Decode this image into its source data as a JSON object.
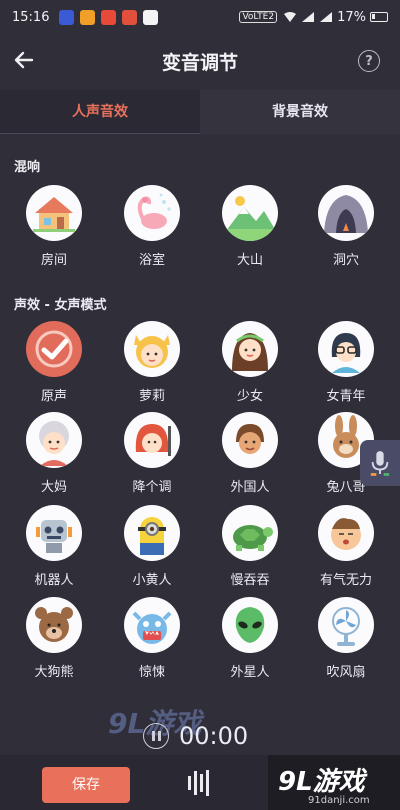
{
  "status_bar": {
    "time": "15:16",
    "network_label": "VoLTE2",
    "battery": "17%"
  },
  "header": {
    "title": "变音调节"
  },
  "tabs": [
    {
      "label": "人声音效",
      "active": true
    },
    {
      "label": "背景音效",
      "active": false
    }
  ],
  "sections": {
    "reverb": {
      "title": "混响",
      "items": [
        {
          "label": "房间",
          "icon": "house-icon"
        },
        {
          "label": "浴室",
          "icon": "flamingo-icon"
        },
        {
          "label": "大山",
          "icon": "mountain-icon"
        },
        {
          "label": "洞穴",
          "icon": "cave-icon"
        }
      ]
    },
    "voice": {
      "title": "声效 - 女声模式",
      "items": [
        {
          "label": "原声",
          "icon": "check-icon"
        },
        {
          "label": "萝莉",
          "icon": "girl-cat-ears-icon"
        },
        {
          "label": "少女",
          "icon": "young-woman-icon"
        },
        {
          "label": "女青年",
          "icon": "glasses-woman-icon"
        },
        {
          "label": "大妈",
          "icon": "granny-icon"
        },
        {
          "label": "降个调",
          "icon": "redhead-icon"
        },
        {
          "label": "外国人",
          "icon": "foreigner-icon"
        },
        {
          "label": "兔八哥",
          "icon": "rabbit-icon"
        },
        {
          "label": "机器人",
          "icon": "robot-icon"
        },
        {
          "label": "小黄人",
          "icon": "minion-icon"
        },
        {
          "label": "慢吞吞",
          "icon": "turtle-icon"
        },
        {
          "label": "有气无力",
          "icon": "sleepy-face-icon"
        },
        {
          "label": "大狗熊",
          "icon": "bear-icon"
        },
        {
          "label": "惊悚",
          "icon": "monster-icon"
        },
        {
          "label": "外星人",
          "icon": "alien-icon"
        },
        {
          "label": "吹风扇",
          "icon": "fan-icon"
        }
      ]
    }
  },
  "player": {
    "time": "00:00"
  },
  "bottom": {
    "save_label": "保存"
  },
  "watermark": {
    "overlay_text": "9L游戏",
    "brand_logo": "9L游戏",
    "brand_url": "91danji.com"
  },
  "colors": {
    "background": "#2f2e39",
    "accent": "#e9715b",
    "avatar_bg": "#fbfafc"
  }
}
